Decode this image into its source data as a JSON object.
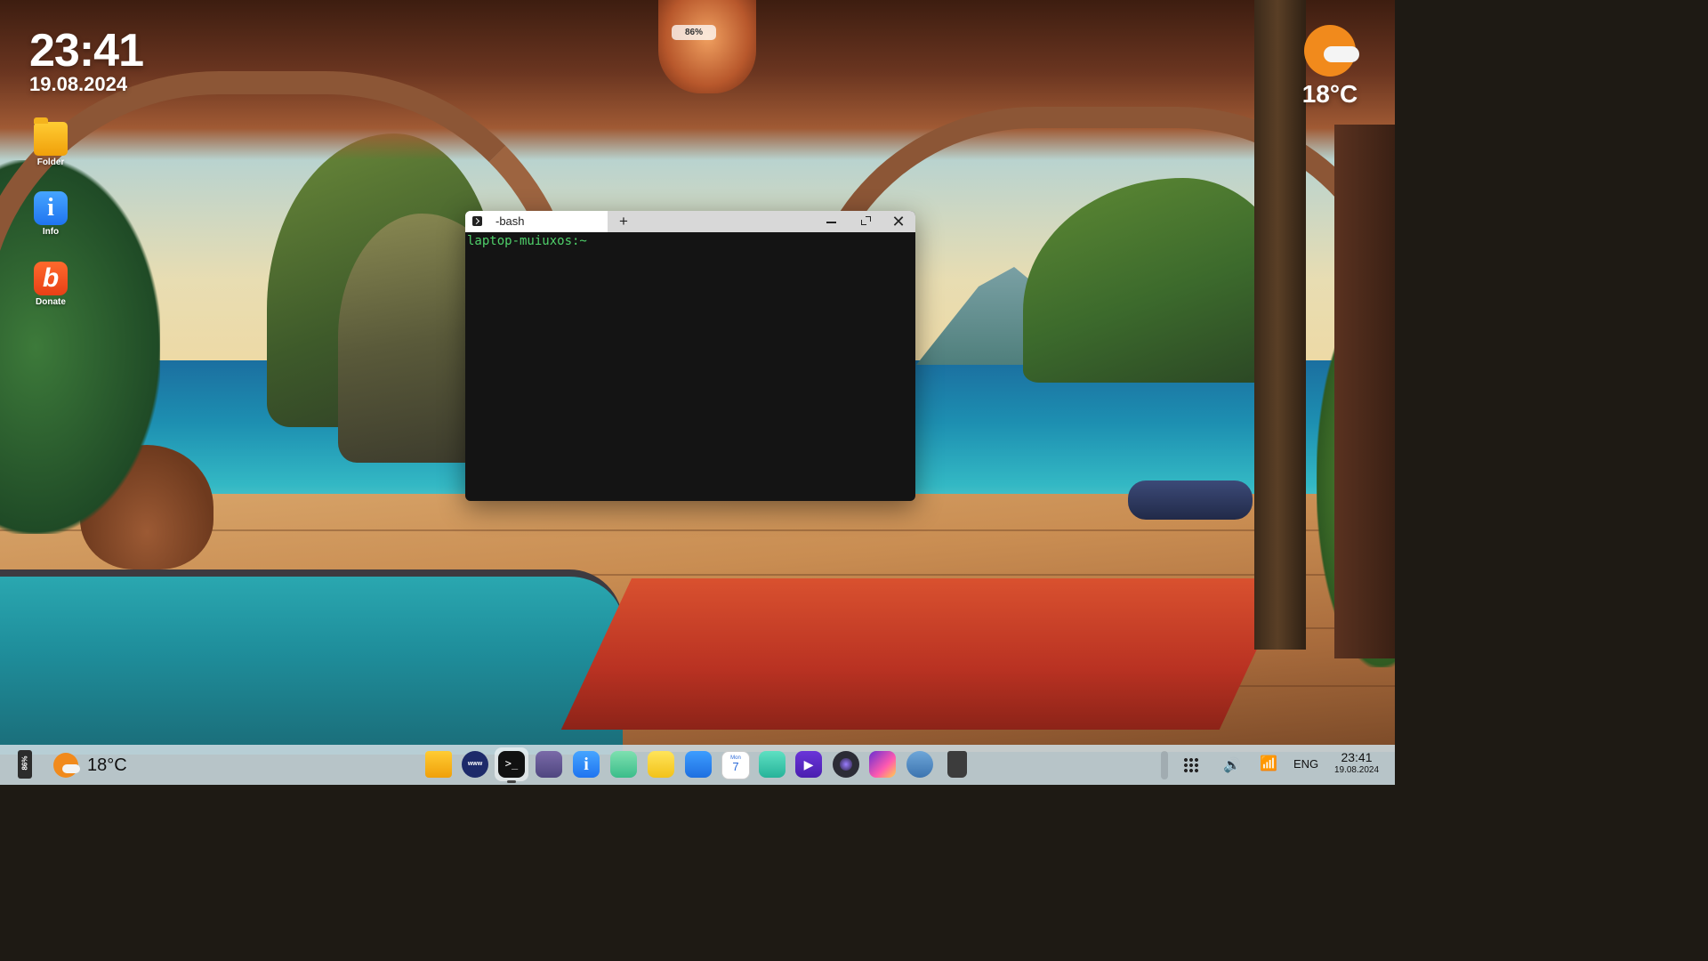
{
  "battery_top": "86%",
  "desktop_clock": {
    "time": "23:41",
    "date": "19.08.2024"
  },
  "weather_widget": {
    "temperature": "18°C",
    "icon": "partly-sunny-icon"
  },
  "desktop_icons": [
    {
      "label": "Folder",
      "icon": "folder-icon"
    },
    {
      "label": "Info",
      "icon": "info-icon",
      "glyph": "i"
    },
    {
      "label": "Donate",
      "icon": "donate-icon",
      "glyph": "b"
    }
  ],
  "terminal": {
    "tab_title": "-bash",
    "new_tab": "+",
    "close": "✕",
    "prompt": "laptop-muiuxos:~",
    "prompt_color": "#4fd06a"
  },
  "taskbar": {
    "battery": "86%",
    "temperature": "18°C",
    "language": "ENG",
    "time": "23:41",
    "date": "19.08.2024",
    "www_label": "www",
    "terminal_glyph": ">_",
    "info_glyph": "i",
    "calendar_day": "7",
    "video_glyph": "▶",
    "volume_glyph": "🔊",
    "wifi_glyph": "📶",
    "dock_apps": [
      "files-icon",
      "browser-icon",
      "terminal-icon",
      "calculator-icon",
      "info-icon",
      "extensions-icon",
      "notes-icon",
      "weather-icon",
      "calendar-icon",
      "photos-icon",
      "video-player-icon",
      "camera-icon",
      "paint-icon",
      "settings-icon",
      "trash-icon"
    ]
  },
  "colors": {
    "accent_orange": "#f18a1c",
    "taskbar_bg": "#cddce1"
  }
}
